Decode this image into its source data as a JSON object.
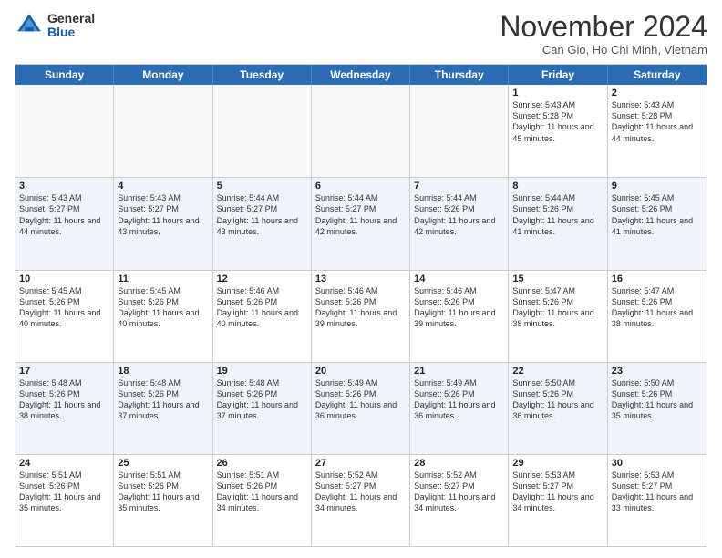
{
  "logo": {
    "general": "General",
    "blue": "Blue"
  },
  "header": {
    "title": "November 2024",
    "location": "Can Gio, Ho Chi Minh, Vietnam"
  },
  "weekdays": [
    "Sunday",
    "Monday",
    "Tuesday",
    "Wednesday",
    "Thursday",
    "Friday",
    "Saturday"
  ],
  "weeks": [
    {
      "alt": false,
      "cells": [
        {
          "day": "",
          "info": ""
        },
        {
          "day": "",
          "info": ""
        },
        {
          "day": "",
          "info": ""
        },
        {
          "day": "",
          "info": ""
        },
        {
          "day": "",
          "info": ""
        },
        {
          "day": "1",
          "info": "Sunrise: 5:43 AM\nSunset: 5:28 PM\nDaylight: 11 hours and 45 minutes."
        },
        {
          "day": "2",
          "info": "Sunrise: 5:43 AM\nSunset: 5:28 PM\nDaylight: 11 hours and 44 minutes."
        }
      ]
    },
    {
      "alt": true,
      "cells": [
        {
          "day": "3",
          "info": "Sunrise: 5:43 AM\nSunset: 5:27 PM\nDaylight: 11 hours and 44 minutes."
        },
        {
          "day": "4",
          "info": "Sunrise: 5:43 AM\nSunset: 5:27 PM\nDaylight: 11 hours and 43 minutes."
        },
        {
          "day": "5",
          "info": "Sunrise: 5:44 AM\nSunset: 5:27 PM\nDaylight: 11 hours and 43 minutes."
        },
        {
          "day": "6",
          "info": "Sunrise: 5:44 AM\nSunset: 5:27 PM\nDaylight: 11 hours and 42 minutes."
        },
        {
          "day": "7",
          "info": "Sunrise: 5:44 AM\nSunset: 5:26 PM\nDaylight: 11 hours and 42 minutes."
        },
        {
          "day": "8",
          "info": "Sunrise: 5:44 AM\nSunset: 5:26 PM\nDaylight: 11 hours and 41 minutes."
        },
        {
          "day": "9",
          "info": "Sunrise: 5:45 AM\nSunset: 5:26 PM\nDaylight: 11 hours and 41 minutes."
        }
      ]
    },
    {
      "alt": false,
      "cells": [
        {
          "day": "10",
          "info": "Sunrise: 5:45 AM\nSunset: 5:26 PM\nDaylight: 11 hours and 40 minutes."
        },
        {
          "day": "11",
          "info": "Sunrise: 5:45 AM\nSunset: 5:26 PM\nDaylight: 11 hours and 40 minutes."
        },
        {
          "day": "12",
          "info": "Sunrise: 5:46 AM\nSunset: 5:26 PM\nDaylight: 11 hours and 40 minutes."
        },
        {
          "day": "13",
          "info": "Sunrise: 5:46 AM\nSunset: 5:26 PM\nDaylight: 11 hours and 39 minutes."
        },
        {
          "day": "14",
          "info": "Sunrise: 5:46 AM\nSunset: 5:26 PM\nDaylight: 11 hours and 39 minutes."
        },
        {
          "day": "15",
          "info": "Sunrise: 5:47 AM\nSunset: 5:26 PM\nDaylight: 11 hours and 38 minutes."
        },
        {
          "day": "16",
          "info": "Sunrise: 5:47 AM\nSunset: 5:26 PM\nDaylight: 11 hours and 38 minutes."
        }
      ]
    },
    {
      "alt": true,
      "cells": [
        {
          "day": "17",
          "info": "Sunrise: 5:48 AM\nSunset: 5:26 PM\nDaylight: 11 hours and 38 minutes."
        },
        {
          "day": "18",
          "info": "Sunrise: 5:48 AM\nSunset: 5:26 PM\nDaylight: 11 hours and 37 minutes."
        },
        {
          "day": "19",
          "info": "Sunrise: 5:48 AM\nSunset: 5:26 PM\nDaylight: 11 hours and 37 minutes."
        },
        {
          "day": "20",
          "info": "Sunrise: 5:49 AM\nSunset: 5:26 PM\nDaylight: 11 hours and 36 minutes."
        },
        {
          "day": "21",
          "info": "Sunrise: 5:49 AM\nSunset: 5:26 PM\nDaylight: 11 hours and 36 minutes."
        },
        {
          "day": "22",
          "info": "Sunrise: 5:50 AM\nSunset: 5:26 PM\nDaylight: 11 hours and 36 minutes."
        },
        {
          "day": "23",
          "info": "Sunrise: 5:50 AM\nSunset: 5:26 PM\nDaylight: 11 hours and 35 minutes."
        }
      ]
    },
    {
      "alt": false,
      "cells": [
        {
          "day": "24",
          "info": "Sunrise: 5:51 AM\nSunset: 5:26 PM\nDaylight: 11 hours and 35 minutes."
        },
        {
          "day": "25",
          "info": "Sunrise: 5:51 AM\nSunset: 5:26 PM\nDaylight: 11 hours and 35 minutes."
        },
        {
          "day": "26",
          "info": "Sunrise: 5:51 AM\nSunset: 5:26 PM\nDaylight: 11 hours and 34 minutes."
        },
        {
          "day": "27",
          "info": "Sunrise: 5:52 AM\nSunset: 5:27 PM\nDaylight: 11 hours and 34 minutes."
        },
        {
          "day": "28",
          "info": "Sunrise: 5:52 AM\nSunset: 5:27 PM\nDaylight: 11 hours and 34 minutes."
        },
        {
          "day": "29",
          "info": "Sunrise: 5:53 AM\nSunset: 5:27 PM\nDaylight: 11 hours and 34 minutes."
        },
        {
          "day": "30",
          "info": "Sunrise: 5:53 AM\nSunset: 5:27 PM\nDaylight: 11 hours and 33 minutes."
        }
      ]
    }
  ]
}
